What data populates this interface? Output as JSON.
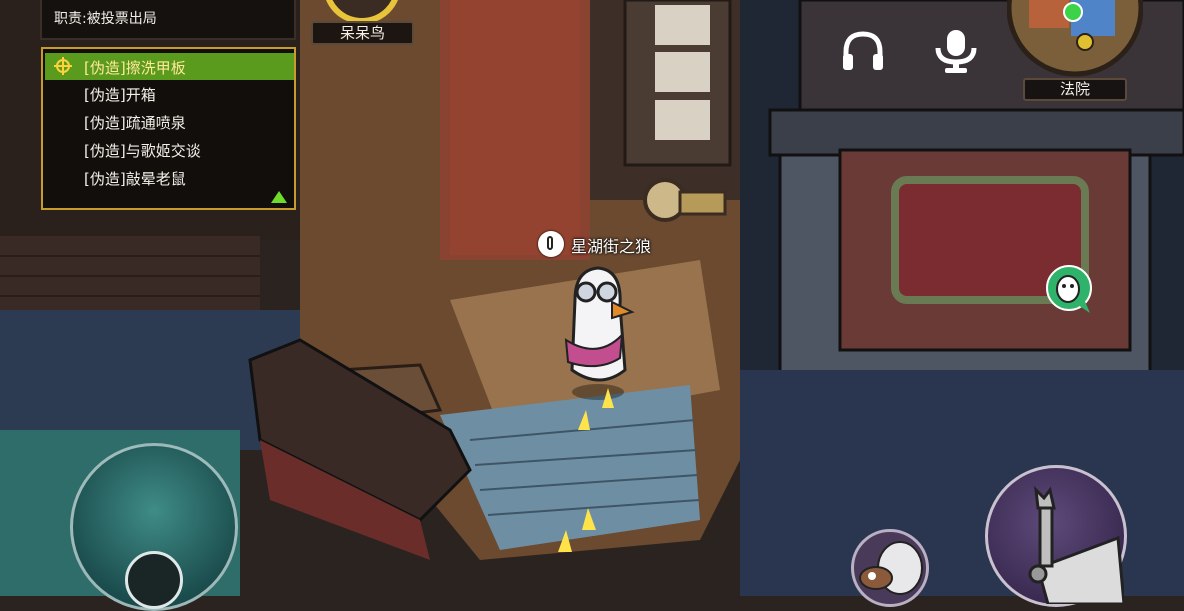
{
  "hud": {
    "role_text": "职责:被投票出局",
    "tasks": [
      {
        "label": "[伪造]擦洗甲板",
        "active": true
      },
      {
        "label": "[伪造]开箱",
        "active": false
      },
      {
        "label": "[伪造]疏通喷泉",
        "active": false
      },
      {
        "label": "[伪造]与歌姬交谈",
        "active": false
      },
      {
        "label": "[伪造]敲晕老鼠",
        "active": false
      }
    ],
    "teammate_name": "呆呆鸟",
    "location_name": "法院",
    "player_name": "星湖街之狼"
  },
  "icons": {
    "task_target": "crosshair-icon",
    "scroll": "triangle-up-icon",
    "voice": "headphones-icon",
    "mic": "microphone-icon",
    "report": "goose-chat-icon",
    "use": "wrench-arm-icon"
  },
  "colors": {
    "task_active_bg": "#5a9a1c",
    "task_border": "#c89b2e",
    "action_button": "#3b2b52"
  }
}
